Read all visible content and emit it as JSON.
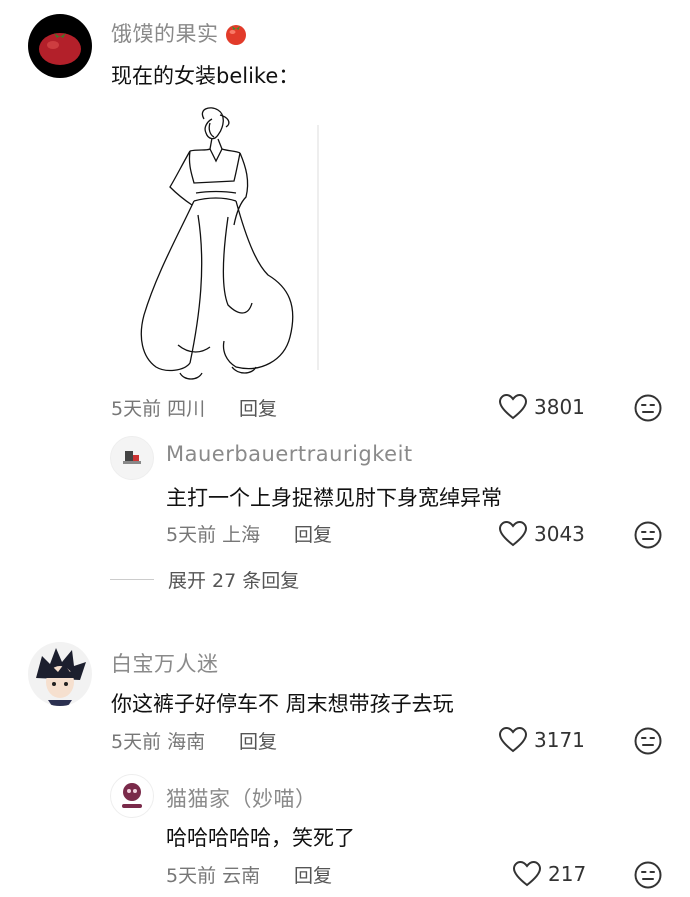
{
  "comments": [
    {
      "username": "饿馍的果实",
      "username_emoji": "tomato",
      "text": "现在的女装belike：",
      "meta": "5天前 四川",
      "reply_label": "回复",
      "likes": "3801",
      "replies": [
        {
          "username": "Mauerbauertraurigkeit",
          "text": "主打一个上身捉襟见肘下身宽绰异常",
          "meta": "5天前 上海",
          "reply_label": "回复",
          "likes": "3043"
        }
      ],
      "expand_label": "展开 27 条回复"
    },
    {
      "username": "白宝万人迷",
      "text": "你这裤子好停车不 周末想带孩子去玩",
      "meta": "5天前 海南",
      "reply_label": "回复",
      "likes": "3171",
      "replies": [
        {
          "username": "猫猫家（妙喵）",
          "text": "哈哈哈哈哈，笑死了",
          "meta": "5天前 云南",
          "reply_label": "回复",
          "likes": "217"
        }
      ]
    }
  ],
  "icons": {
    "like": "heart-outline-icon",
    "dislike": "neutral-face-icon",
    "emoji": "tomato-emoji-icon"
  },
  "colors": {
    "username": "#8a8a8a",
    "meta": "#777777",
    "divider": "#cccccc"
  }
}
